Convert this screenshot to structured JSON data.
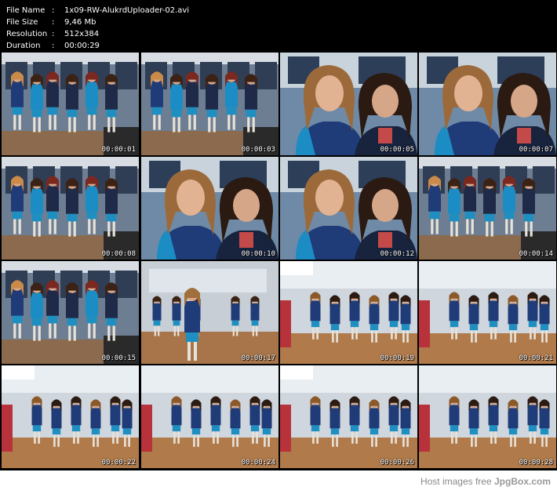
{
  "info": [
    {
      "key": "File Name",
      "sep": ":",
      "value": "1x09-RW-AlukrdUploader-02.avi"
    },
    {
      "key": "File Size",
      "sep": ":",
      "value": "9,46 Mb"
    },
    {
      "key": "Resolution",
      "sep": ":",
      "value": "512x384"
    },
    {
      "key": "Duration",
      "sep": ":",
      "value": "00:00:29"
    }
  ],
  "thumbnails": [
    {
      "time": "00:00:01",
      "scene": "hall"
    },
    {
      "time": "00:00:03",
      "scene": "hall"
    },
    {
      "time": "00:00:05",
      "scene": "closeup"
    },
    {
      "time": "00:00:07",
      "scene": "closeup"
    },
    {
      "time": "00:00:08",
      "scene": "hall"
    },
    {
      "time": "00:00:10",
      "scene": "closeup"
    },
    {
      "time": "00:00:12",
      "scene": "closeup"
    },
    {
      "time": "00:00:14",
      "scene": "hall"
    },
    {
      "time": "00:00:15",
      "scene": "hall"
    },
    {
      "time": "00:00:17",
      "scene": "gym"
    },
    {
      "time": "00:00:19",
      "scene": "dance"
    },
    {
      "time": "00:00:21",
      "scene": "dance"
    },
    {
      "time": "00:00:22",
      "scene": "dance"
    },
    {
      "time": "00:00:24",
      "scene": "dance"
    },
    {
      "time": "00:00:26",
      "scene": "dance"
    },
    {
      "time": "00:00:28",
      "scene": "dance"
    }
  ],
  "footer": {
    "prefix": "Host images free ",
    "brand": "JpgBox.com"
  }
}
